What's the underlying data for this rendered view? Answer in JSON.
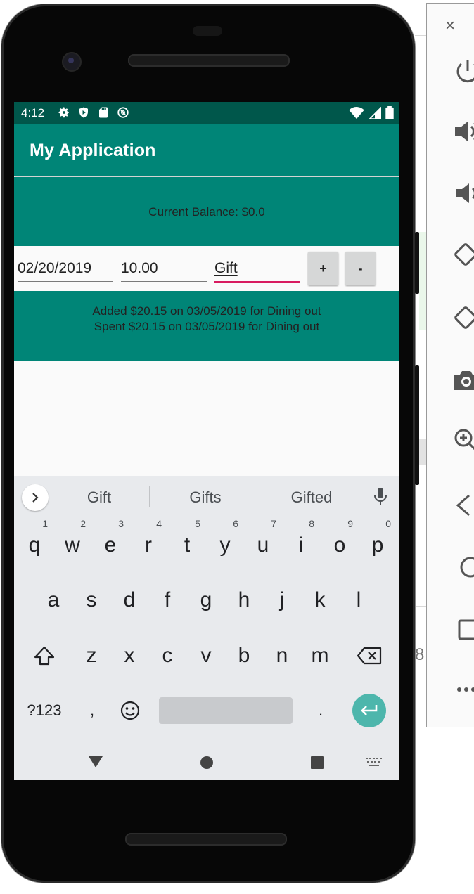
{
  "status_bar": {
    "time": "4:12",
    "left_icons": [
      "settings-icon",
      "shield-play-icon",
      "sd-card-icon",
      "data-saver-icon"
    ],
    "right_icons": [
      "wifi-icon",
      "signal-icon",
      "battery-icon"
    ]
  },
  "app_bar": {
    "title": "My Application"
  },
  "balance": {
    "text": "Current Balance: $0.0"
  },
  "form": {
    "date_value": "02/20/2019",
    "amount_value": "10.00",
    "category_value": "Gift",
    "add_label": "+",
    "subtract_label": "-"
  },
  "history": {
    "lines": [
      "Added $20.15 on 03/05/2019 for Dining out",
      "Spent $20.15 on 03/05/2019 for Dining out"
    ]
  },
  "keyboard": {
    "suggestions": [
      "Gift",
      "Gifts",
      "Gifted"
    ],
    "row1": [
      "q",
      "w",
      "e",
      "r",
      "t",
      "y",
      "u",
      "i",
      "o",
      "p"
    ],
    "row1_hints": [
      "1",
      "2",
      "3",
      "4",
      "5",
      "6",
      "7",
      "8",
      "9",
      "0"
    ],
    "row2": [
      "a",
      "s",
      "d",
      "f",
      "g",
      "h",
      "j",
      "k",
      "l"
    ],
    "row3": [
      "z",
      "x",
      "c",
      "v",
      "b",
      "n",
      "m"
    ],
    "symbols_label": "?123",
    "comma_label": ",",
    "period_label": "."
  },
  "colors": {
    "primary": "#008577",
    "primary_dark": "#00574b",
    "accent": "#d81b60",
    "enter_key": "#4db6ac"
  },
  "emulator_panel": {
    "close_label": "×",
    "tools": [
      "power-icon",
      "volume-up-icon",
      "volume-down-icon",
      "rotate-left-icon",
      "rotate-right-icon",
      "camera-icon",
      "zoom-icon",
      "back-icon",
      "home-icon",
      "overview-icon",
      "more-icon"
    ]
  }
}
